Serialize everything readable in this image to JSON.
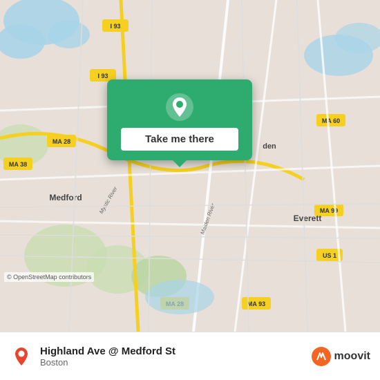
{
  "map": {
    "background_color": "#e8e0d8",
    "attribution": "© OpenStreetMap contributors"
  },
  "popup": {
    "button_label": "Take me there",
    "pin_icon": "location-pin-icon"
  },
  "bottom_bar": {
    "location_name": "Highland Ave @ Medford St",
    "location_city": "Boston",
    "logo_text": "moovit",
    "logo_icon": "moovit-icon"
  }
}
